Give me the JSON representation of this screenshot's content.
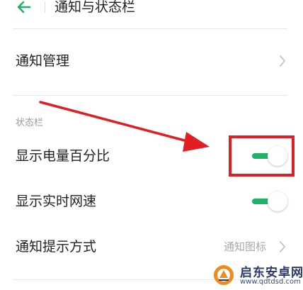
{
  "header": {
    "title": "通知与状态栏"
  },
  "notification_management": {
    "label": "通知管理"
  },
  "status_bar": {
    "section_title": "状态栏",
    "battery_percentage": {
      "label": "显示电量百分比",
      "enabled": true
    },
    "network_speed": {
      "label": "显示实时网速",
      "enabled": true
    },
    "notification_style": {
      "label": "通知提示方式",
      "value": "通知图标"
    }
  },
  "colors": {
    "toggle_on": "#20b26a",
    "annotation_red": "#e01e24",
    "back_arrow": "#20b26a"
  },
  "watermark": {
    "title": "启东安卓网",
    "url": "www.qdtdsd.com"
  }
}
